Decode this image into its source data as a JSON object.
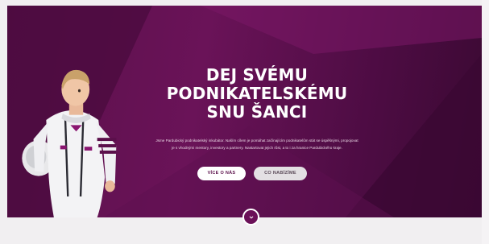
{
  "hero": {
    "title_lines": [
      "DEJ SVÉMU",
      "PODNIKATELSKÉMU",
      "SNU ŠANCI"
    ],
    "description_lines": [
      "Jsme Pardubický podnikatelský inkubátor. Naším cílem je pomáhat začínajícím podnikatelům stát se úspěšnými, propojovat",
      "je s vhodnými mentory, investory a partnery. Nastartovat jejich růst, a to i za hranice Pardubického kraje."
    ],
    "primary_button_label": "VÍCE O NÁS",
    "secondary_button_label": "CO NABÍZÍME",
    "scroll_icon": "chevron-down-icon"
  },
  "colors": {
    "brand": "#6a1358",
    "brand_dark": "#3a0932",
    "background": "#f1eff1"
  }
}
